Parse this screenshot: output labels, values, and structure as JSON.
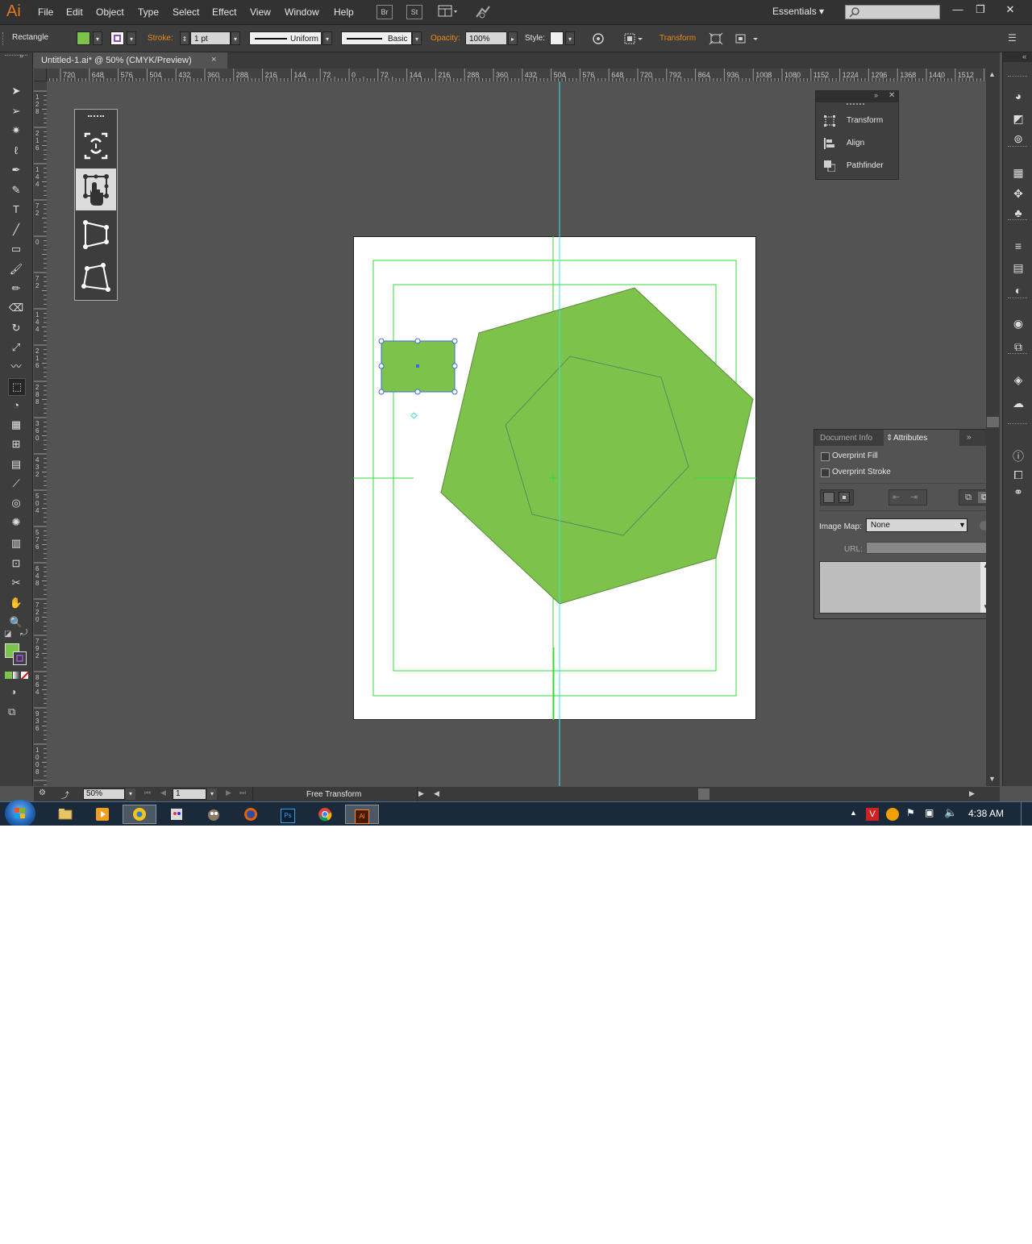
{
  "app": {
    "logo": "Ai",
    "menu": [
      "File",
      "Edit",
      "Object",
      "Type",
      "Select",
      "Effect",
      "View",
      "Window",
      "Help"
    ],
    "bridge_label": "Br",
    "stock_label": "St",
    "workspace": "Essentials",
    "window_controls": {
      "minimize": "—",
      "restore": "❐",
      "close": "✕"
    }
  },
  "control_bar": {
    "tool_name": "Rectangle",
    "stroke_label": "Stroke:",
    "stroke_weight": "1 pt",
    "profile": "Uniform",
    "brush": "Basic",
    "opacity_label": "Opacity:",
    "opacity_value": "100%",
    "style_label": "Style:",
    "transform_label": "Transform",
    "fill_color": "#7dc24a",
    "stroke_color": "#8a4fc4"
  },
  "document": {
    "tab_title": "Untitled-1.ai* @ 50% (CMYK/Preview)",
    "close": "×"
  },
  "rulers": {
    "horizontal": [
      "720",
      "648",
      "576",
      "504",
      "432",
      "360",
      "288",
      "216",
      "144",
      "72",
      "0",
      "72",
      "144",
      "216",
      "288",
      "360",
      "432",
      "504",
      "576",
      "648",
      "720",
      "792",
      "864",
      "936",
      "1008",
      "1080",
      "1152",
      "1224",
      "1296",
      "1368",
      "1440",
      "1512"
    ],
    "vertical": [
      "1 2 8",
      "2 1 6",
      "1 4 4",
      "7 2",
      "0",
      "7 2",
      "1 4 4",
      "2 1 6",
      "2 8 8",
      "3 6 0",
      "4 3 2",
      "5 0 4",
      "5 7 6",
      "6 4 8",
      "7 2 0",
      "7 9 2",
      "8 6 4",
      "9 3 6",
      "1 0 0 8"
    ]
  },
  "tools": {
    "icons": [
      "selection-tool",
      "direct-selection-tool",
      "magic-wand-tool",
      "lasso-tool",
      "pen-tool",
      "curvature-tool",
      "type-tool",
      "line-tool",
      "rectangle-tool",
      "paintbrush-tool",
      "pencil-tool",
      "eraser-tool",
      "rotate-tool",
      "scale-tool",
      "warp-tool",
      "free-transform-tool",
      "shape-builder-tool",
      "perspective-grid-tool",
      "mesh-tool",
      "gradient-tool",
      "eyedropper-tool",
      "blend-tool",
      "symbol-sprayer-tool",
      "column-graph-tool",
      "artboard-tool",
      "slice-tool",
      "hand-tool",
      "zoom-tool"
    ],
    "fill_color": "#7dc24a"
  },
  "free_transform_widget": {
    "options": [
      "constrain",
      "free-transform",
      "perspective-distort",
      "free-distort"
    ]
  },
  "panels": {
    "transform_align_pathfinder": [
      "Transform",
      "Align",
      "Pathfinder"
    ],
    "attributes": {
      "tab_document_info": "Document Info",
      "tab_attributes": "Attributes",
      "overprint_fill": "Overprint Fill",
      "overprint_stroke": "Overprint Stroke",
      "image_map_label": "Image Map:",
      "image_map_value": "None",
      "url_label": "URL:"
    }
  },
  "status": {
    "zoom": "50%",
    "artboard_number": "1",
    "current_tool": "Free Transform"
  },
  "taskbar": {
    "clock": "4:38 AM",
    "apps": [
      "start",
      "explorer",
      "media",
      "chrome-canary",
      "paint",
      "gimp",
      "firefox",
      "photoshop",
      "chrome",
      "illustrator"
    ]
  },
  "colors": {
    "shape_fill": "#7dc24a",
    "guide_cyan": "#3fe0e0",
    "guide_green": "#33dd33",
    "selection_blue": "#3a6ad8"
  }
}
